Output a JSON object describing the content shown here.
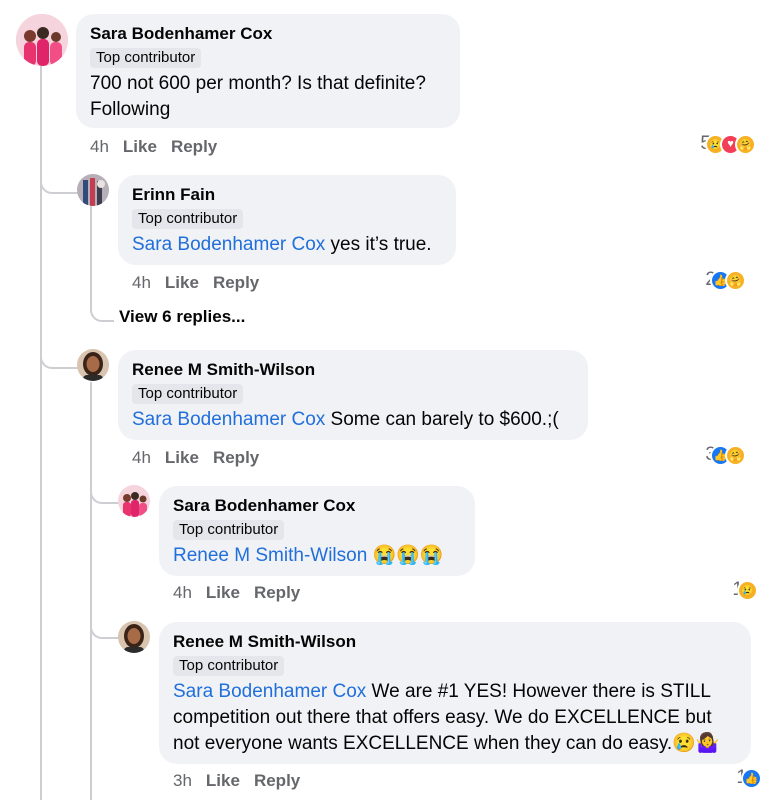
{
  "comments": [
    {
      "author": "Sara Bodenhamer Cox",
      "badge": "Top contributor",
      "text": "700 not 600 per month? Is that definite? Following",
      "time": "4h",
      "like": "Like",
      "reply": "Reply",
      "reaction_count": "5",
      "reactions": [
        "sad",
        "love",
        "care"
      ]
    },
    {
      "author": "Erinn Fain",
      "badge": "Top contributor",
      "mention": "Sara Bodenhamer Cox",
      "text": " yes it’s true.",
      "time": "4h",
      "like": "Like",
      "reply": "Reply",
      "reaction_count": "2",
      "reactions": [
        "like",
        "care"
      ]
    },
    {
      "author": "Renee M Smith-Wilson",
      "badge": "Top contributor",
      "mention": "Sara Bodenhamer Cox",
      "text": " Some can barely to $600.;(",
      "time": "4h",
      "like": "Like",
      "reply": "Reply",
      "reaction_count": "3",
      "reactions": [
        "like",
        "care"
      ]
    },
    {
      "author": "Sara Bodenhamer Cox",
      "badge": "Top contributor",
      "mention": "Renee M Smith-Wilson",
      "text": " 😭😭😭",
      "time": "4h",
      "like": "Like",
      "reply": "Reply",
      "reaction_count": "1",
      "reactions": [
        "sad"
      ]
    },
    {
      "author": "Renee M Smith-Wilson",
      "badge": "Top contributor",
      "mention": "Sara Bodenhamer Cox",
      "text": " We are #1 YES! However there is STILL competition out there that offers easy. We do EXCELLENCE but not everyone wants EXCELLENCE when they can do easy.",
      "text_emoji": "😢🤷‍♀️",
      "time": "3h",
      "like": "Like",
      "reply": "Reply",
      "reaction_count": "1",
      "reactions": [
        "like"
      ]
    }
  ],
  "view_replies": "View 6 replies...",
  "colors": {
    "bubble": "#f0f2f5",
    "badge": "#e4e6eb",
    "mention": "#216fdb",
    "meta": "#65676b",
    "thread_line": "#ccced2",
    "like_blue": "#1877f2",
    "love_red": "#f33e58",
    "reaction_yellow": "#f7b125"
  }
}
